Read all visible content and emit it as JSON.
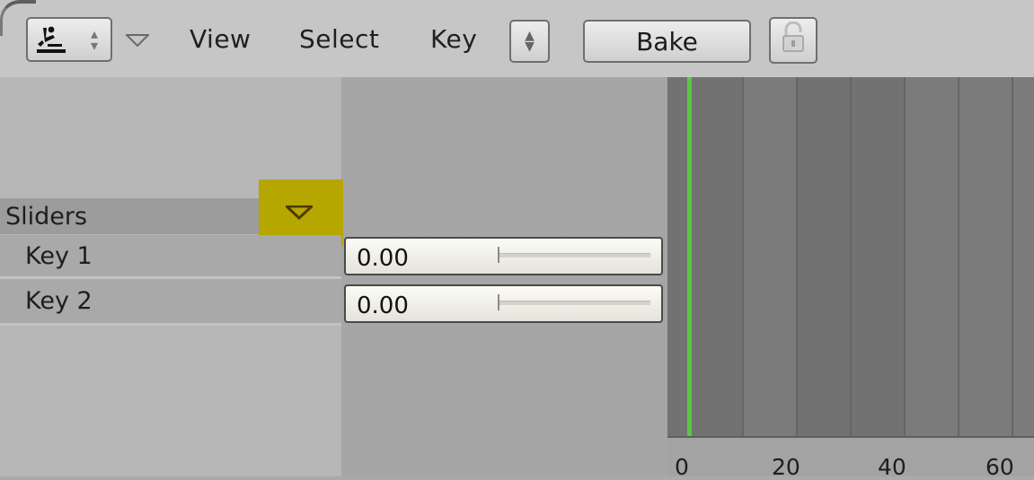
{
  "header": {
    "editor_type_icon": "action-editor-icon",
    "menus": [
      "View",
      "Select",
      "Key"
    ],
    "bake_label": "Bake",
    "lock_icon": "lock-open-icon"
  },
  "channels": {
    "group_label": "Sliders",
    "rows": [
      {
        "label": "Key 1",
        "value": "0.00"
      },
      {
        "label": "Key 2",
        "value": "0.00"
      }
    ]
  },
  "timeline": {
    "current_frame": 0,
    "ticks": [
      "0",
      "20",
      "40",
      "60"
    ],
    "current_frame_color": "#59c944"
  },
  "colors": {
    "header_bg": "#c6c6c6",
    "channel_bg": "#b7b7b7",
    "highlight": "#b6a600",
    "timeline_bg": "#7b7b7b"
  }
}
